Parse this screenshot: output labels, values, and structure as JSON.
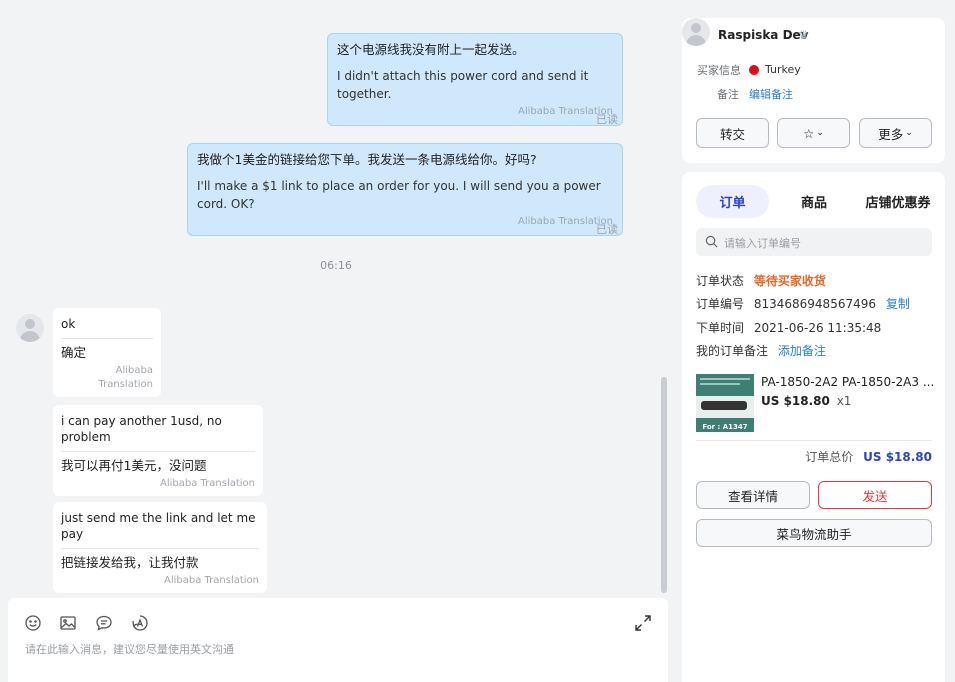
{
  "chat": {
    "outgoing": [
      {
        "original": "这个电源线我没有附上一起发送。",
        "translation": "I didn't attach this power cord and send it together.",
        "source": "Alibaba Translation",
        "status": "已读"
      },
      {
        "original": "我做个1美金的链接给您下单。我发送一条电源线给你。好吗?",
        "translation": "I'll make a $1 link to place an order for you. I will send you a power cord. OK?",
        "source": "Alibaba Translation",
        "status": "已读"
      }
    ],
    "time_divider": "06:16",
    "incoming": [
      {
        "original": "ok",
        "translation": "确定",
        "source": "Alibaba Translation"
      },
      {
        "original": "i can pay another 1usd, no problem",
        "translation": "我可以再付1美元，没问题",
        "source": "Alibaba Translation"
      },
      {
        "original": "just send me the link and let me pay",
        "translation": "把链接发给我，让我付款",
        "source": "Alibaba Translation"
      }
    ]
  },
  "composer": {
    "placeholder": "请在此输入消息，建议您尽量使用英文沟通",
    "tools": [
      "emoji-icon",
      "image-icon",
      "quick-reply-icon",
      "translate-icon"
    ]
  },
  "buyer": {
    "name": "Raspiska Dev",
    "info_label": "买家信息",
    "country": "Turkey",
    "note_label": "备注",
    "note_action": "编辑备注",
    "buttons": {
      "transfer": "转交",
      "star": "☆",
      "more": "更多"
    }
  },
  "order_panel": {
    "tabs": [
      "订单",
      "商品",
      "店铺优惠券"
    ],
    "active_tab": 0,
    "search_placeholder": "请输入订单编号",
    "status_label": "订单状态",
    "status_value": "等待买家收货",
    "number_label": "订单编号",
    "number_value": "8134686948567496",
    "copy_label": "复制",
    "time_label": "下单时间",
    "time_value": "2021-06-26 11:35:48",
    "remark_label": "我的订单备注",
    "remark_action": "添加备注",
    "product": {
      "title": "PA-1850-2A2 PA-1850-2A3 ...",
      "price": "US $18.80",
      "qty": "x1",
      "thumb_label": "For : A1347"
    },
    "total_label": "订单总价",
    "total_value": "US $18.80",
    "detail_button": "查看详情",
    "send_button": "发送",
    "logistics_button": "菜鸟物流助手"
  },
  "colors": {
    "accent": "#2a45c8",
    "status": "#e8692a",
    "link": "#2b7fd1",
    "send": "#e0393e",
    "out_bubble": "#cfe8fb"
  }
}
